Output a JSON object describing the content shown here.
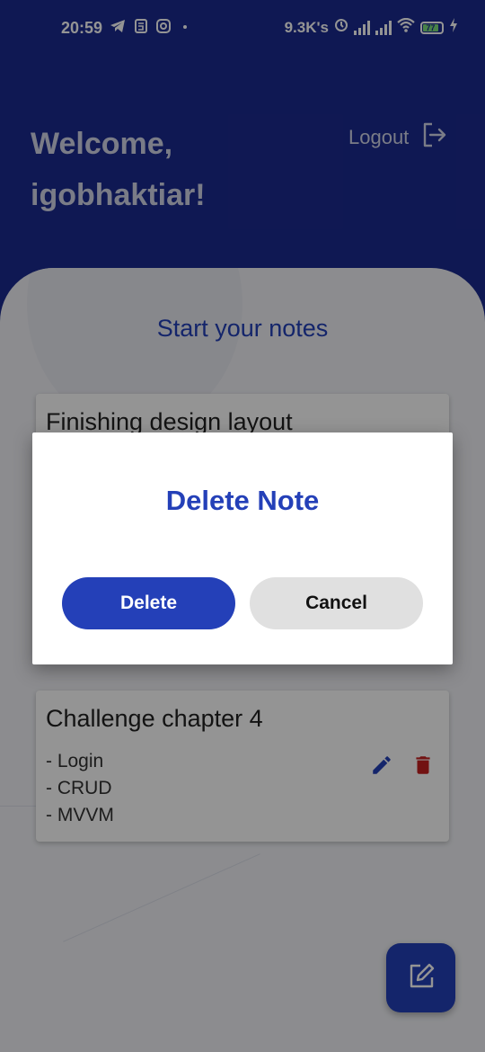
{
  "status_bar": {
    "time": "20:59",
    "network_speed": "9.3K's",
    "battery_level": "77",
    "battery_fraction": 0.77,
    "left_icons": [
      "telegram-icon",
      "notification-5-icon",
      "instagram-icon",
      "dot-icon"
    ],
    "right_icons": [
      "alarm-icon",
      "signal-icon",
      "signal-icon",
      "wifi-icon",
      "battery-icon",
      "charging-icon"
    ]
  },
  "header": {
    "welcome_line1": "Welcome,",
    "welcome_line2": "igobhaktiar!",
    "logout_label": "Logout",
    "logout_icon": "logout-icon",
    "background_color": "#1b2a8f"
  },
  "main": {
    "title": "Start your notes",
    "notes": [
      {
        "title": "Finishing design layout",
        "body": [],
        "actions": [
          "edit-icon",
          "delete-icon"
        ]
      },
      {
        "title": "Challenge chapter 4",
        "body": [
          "- Login",
          "- CRUD",
          "- MVVM"
        ],
        "actions": [
          "edit-icon",
          "delete-icon"
        ]
      }
    ],
    "fab_icon": "edit-note-icon"
  },
  "dialog": {
    "title": "Delete Note",
    "confirm_label": "Delete",
    "cancel_label": "Cancel"
  },
  "colors": {
    "accent": "#2440b8",
    "delete_red": "#c51f1f",
    "cancel_bg": "#e0e0e0"
  }
}
